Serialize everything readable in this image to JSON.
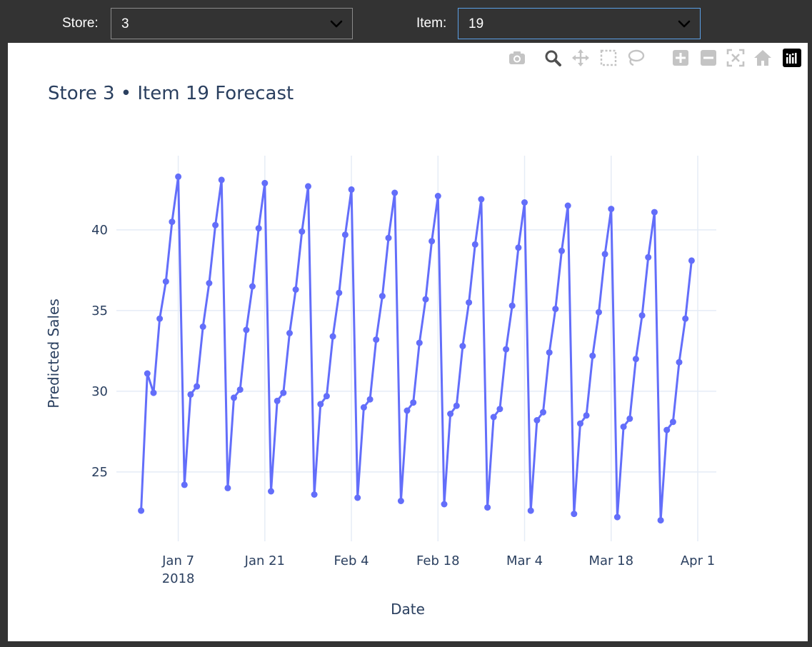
{
  "controls": {
    "store_label": "Store:",
    "store_value": "3",
    "item_label": "Item:",
    "item_value": "19"
  },
  "modebar": {
    "buttons": [
      "camera-icon",
      "zoom-icon",
      "pan-icon",
      "box-select-icon",
      "lasso-icon",
      "zoom-in-icon",
      "zoom-out-icon",
      "autoscale-icon",
      "reset-axes-icon",
      "plotly-logo-icon"
    ]
  },
  "colors": {
    "series": "#636efa",
    "grid": "#e5ecf6",
    "text": "#2a3f5f"
  },
  "chart_data": {
    "type": "line",
    "mode": "lines+markers",
    "title": "Store 3 • Item 19 Forecast",
    "xlabel": "Date",
    "ylabel": "Predicted Sales",
    "grid": true,
    "x_start": "2018-01-01",
    "x_step_days": 1,
    "xlim": [
      "2017-12-28",
      "2018-04-04"
    ],
    "ylim": [
      20.7,
      44.6
    ],
    "x_ticks": [
      {
        "date": "2018-01-07",
        "label": "Jan 7",
        "sublabel": "2018"
      },
      {
        "date": "2018-01-21",
        "label": "Jan 21"
      },
      {
        "date": "2018-02-04",
        "label": "Feb 4"
      },
      {
        "date": "2018-02-18",
        "label": "Feb 18"
      },
      {
        "date": "2018-03-04",
        "label": "Mar 4"
      },
      {
        "date": "2018-03-18",
        "label": "Mar 18"
      },
      {
        "date": "2018-04-01",
        "label": "Apr 1"
      }
    ],
    "y_ticks": [
      25,
      30,
      35,
      40
    ],
    "series": [
      {
        "values": [
          22.6,
          31.1,
          29.9,
          34.5,
          36.8,
          40.5,
          43.3,
          24.2,
          29.8,
          30.3,
          34.0,
          36.7,
          40.3,
          43.1,
          24.0,
          29.6,
          30.1,
          33.8,
          36.5,
          40.1,
          42.9,
          23.8,
          29.4,
          29.9,
          33.6,
          36.3,
          39.9,
          42.7,
          23.6,
          29.2,
          29.7,
          33.4,
          36.1,
          39.7,
          42.5,
          23.4,
          29.0,
          29.5,
          33.2,
          35.9,
          39.5,
          42.3,
          23.2,
          28.8,
          29.3,
          33.0,
          35.7,
          39.3,
          42.1,
          23.0,
          28.6,
          29.1,
          32.8,
          35.5,
          39.1,
          41.9,
          22.8,
          28.4,
          28.9,
          32.6,
          35.3,
          38.9,
          41.7,
          22.6,
          28.2,
          28.7,
          32.4,
          35.1,
          38.7,
          41.5,
          22.4,
          28.0,
          28.5,
          32.2,
          34.9,
          38.5,
          41.3,
          22.2,
          27.8,
          28.3,
          32.0,
          34.7,
          38.3,
          41.1,
          22.0,
          27.6,
          28.1,
          31.8,
          34.5,
          38.1
        ]
      }
    ]
  }
}
